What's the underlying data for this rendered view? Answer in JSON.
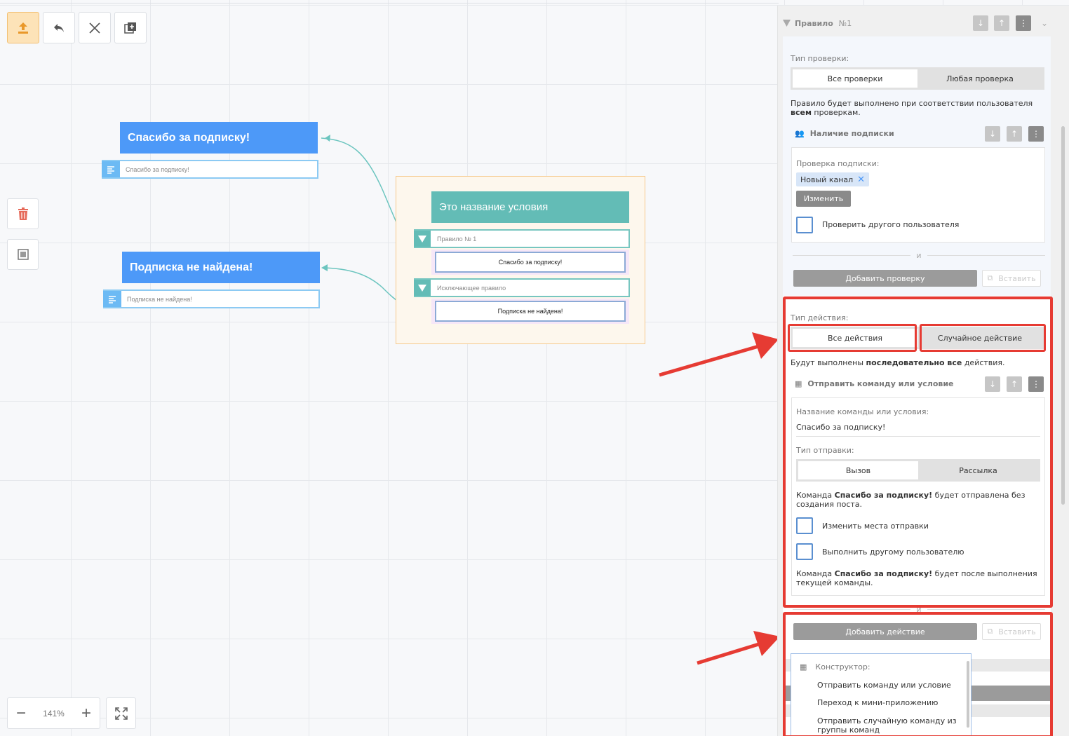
{
  "toolbar": {
    "upload": "upload-icon",
    "undo": "undo-icon",
    "close": "close-icon",
    "add": "add-copy-icon"
  },
  "zoom": {
    "minus": "−",
    "value": "141%",
    "plus": "+"
  },
  "canvas": {
    "node1": {
      "title": "Спасибо за подписку!",
      "row": "Спасибо за подписку!"
    },
    "node2": {
      "title": "Подписка не найдена!",
      "row": "Подписка не найдена!"
    },
    "condition": {
      "title": "Это название условия",
      "rule1": "Правило № 1",
      "rule1_target": "Спасибо за подписку!",
      "rule2": "Исключающее правило",
      "rule2_target": "Подписка не найдена!"
    }
  },
  "panel": {
    "title": "Правило",
    "number": "№1",
    "check_type_label": "Тип проверки:",
    "check_type_options": [
      "Все проверки",
      "Любая проверка"
    ],
    "check_desc_pre": "Правило будет выполнено при соответствии пользователя ",
    "check_desc_bold": "всем",
    "check_desc_post": " проверкам.",
    "subscription": {
      "title": "Наличие подписки",
      "field_label": "Проверка подписки:",
      "chip": "Новый канал",
      "change_button": "Изменить",
      "other_user": "Проверить другого пользователя"
    },
    "and": "и",
    "add_check": "Добавить проверку",
    "paste": "Вставить",
    "action_type_label": "Тип действия:",
    "action_type_options": [
      "Все действия",
      "Случайное действие"
    ],
    "action_desc_pre": "Будут выполнены ",
    "action_desc_bold": "последовательно все",
    "action_desc_post": " действия.",
    "send_command": {
      "title": "Отправить команду или условие",
      "name_label": "Название команды или условия:",
      "name_value": "Спасибо за подписку!",
      "send_type_label": "Тип отправки:",
      "send_type_options": [
        "Вызов",
        "Рассылка"
      ],
      "note1_pre": "Команда ",
      "note1_bold": "Спасибо за подписку!",
      "note1_post": " будет отправлена без создания поста.",
      "change_places": "Изменить места отправки",
      "other_user": "Выполнить другому пользователю",
      "note2_pre": "Команда ",
      "note2_bold": "Спасибо за подписку!",
      "note2_post": " будет после выполнения текущей команды."
    },
    "add_action": "Добавить действие",
    "dropdown": {
      "header": "Конструктор:",
      "items": [
        "Отправить команду или условие",
        "Переход к мини-приложению",
        "Отправить случайную команду из группы команд"
      ]
    }
  },
  "colors": {
    "accent_blue": "#4d99f8",
    "teal": "#63bcb6",
    "highlight_red": "#e63b33",
    "toolbar_active": "#fde3b8"
  }
}
